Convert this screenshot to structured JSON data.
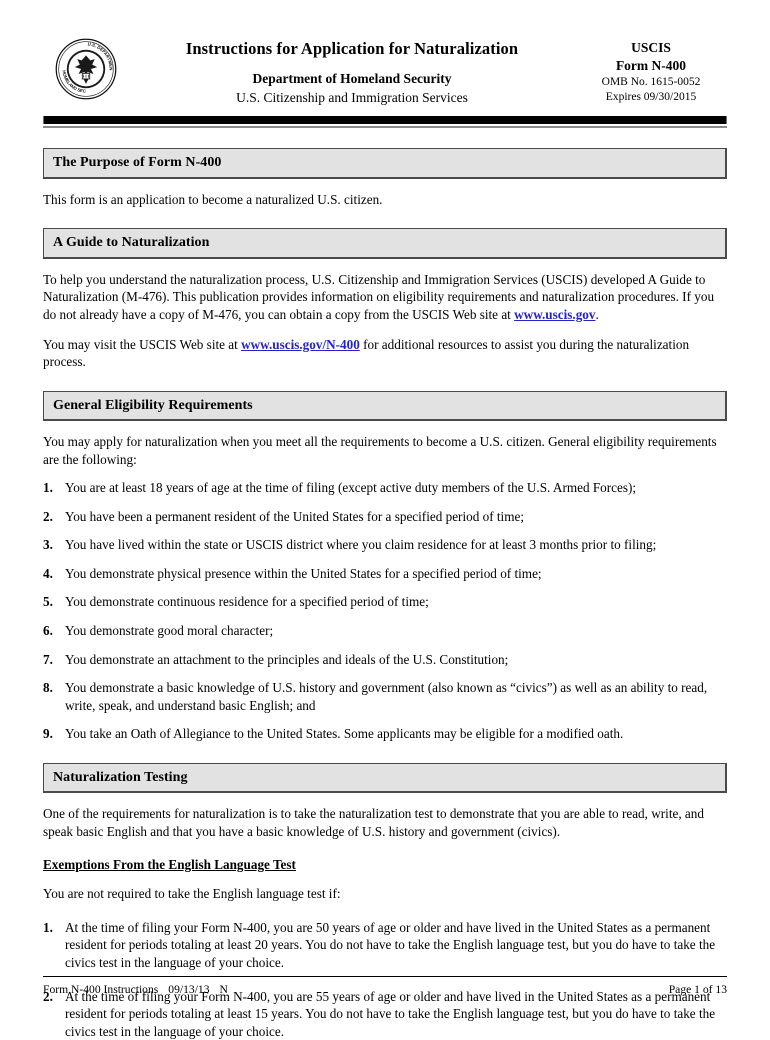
{
  "header": {
    "seal_icon": "dhs-seal-icon",
    "title": "Instructions for Application for Naturalization",
    "department": "Department of Homeland Security",
    "agency": "U.S. Citizenship and Immigration Services",
    "agency_abbr": "USCIS",
    "form_number": "Form N-400",
    "omb_number": "OMB No. 1615-0052",
    "expires": "Expires 09/30/2015"
  },
  "sections": {
    "purpose": {
      "heading": "The Purpose of Form N-400",
      "paragraph": "This form is an application to become a naturalized U.S. citizen."
    },
    "guide": {
      "heading": "A Guide to Naturalization",
      "paragraph1_before": "To help you understand the naturalization process, U.S. Citizenship and Immigration Services (USCIS) developed A Guide to Naturalization (M-476).  This publication provides information on eligibility requirements and naturalization procedures.  If you do not already have a copy of M-476, you can obtain a copy from the USCIS Web site at ",
      "link1": "www.uscis.gov",
      "paragraph1_after": ".",
      "paragraph2_before": "You may visit the USCIS Web site at ",
      "link2": "www.uscis.gov/N-400",
      "paragraph2_after": " for additional resources to assist you during the naturalization process."
    },
    "eligibility": {
      "heading": "General Eligibility Requirements",
      "intro": "You may apply for naturalization when you meet all the requirements to become a U.S. citizen.  General eligibility requirements are the following:",
      "items": [
        {
          "num": "1.",
          "text": "You are at least 18 years of age at the time of filing (except active duty members of the U.S. Armed Forces);"
        },
        {
          "num": "2.",
          "text": "You have been a permanent resident of the United States for a specified period of time;"
        },
        {
          "num": "3.",
          "text": "You have lived within the state or USCIS district where you claim residence for at least 3 months prior to filing;"
        },
        {
          "num": "4.",
          "text": "You demonstrate physical presence within the United States for a specified period of time;"
        },
        {
          "num": "5.",
          "text": "You demonstrate continuous residence for a specified period of time;"
        },
        {
          "num": "6.",
          "text": "You demonstrate good moral character;"
        },
        {
          "num": "7.",
          "text": "You demonstrate an attachment to the principles and ideals of the U.S. Constitution;"
        },
        {
          "num": "8.",
          "text": "You demonstrate a basic knowledge of U.S. history and government (also known as “civics”) as well as an ability to read, write, speak, and understand basic English; and"
        },
        {
          "num": "9.",
          "text": "You take an Oath of Allegiance to the United States.  Some applicants may be eligible for a modified oath."
        }
      ]
    },
    "testing": {
      "heading": "Naturalization Testing",
      "intro": "One of the requirements for naturalization is to take the naturalization test to demonstrate that you are able to read, write, and speak basic English and that you have a basic knowledge of U.S. history and government (civics).",
      "subheading": "Exemptions From the English Language Test",
      "sub_intro": "You are not required to take the English language test if:",
      "items": [
        {
          "num": "1.",
          "text": "At the time of filing your Form N-400, you are 50 years of age or older and have lived in the United States as a permanent resident for periods totaling at least 20 years.  You do not have to take the English language test, but you do have to take the civics test in the language of your choice."
        },
        {
          "num": "2.",
          "text": "At the time of filing your Form N-400, you are 55 years of age or older and have lived in the United States as a permanent resident for periods totaling at least 15 years.  You do not have to take the English language test, but you do have to take the civics test in the language of your choice."
        }
      ]
    }
  },
  "footer": {
    "form_label": "Form N-400 Instructions",
    "date": "09/13/13",
    "revision": "N",
    "page": "Page 1 of 13"
  },
  "colors": {
    "link": "#2323cc",
    "section_bar_fill": "#e2e2e2",
    "rule": "#000000"
  }
}
